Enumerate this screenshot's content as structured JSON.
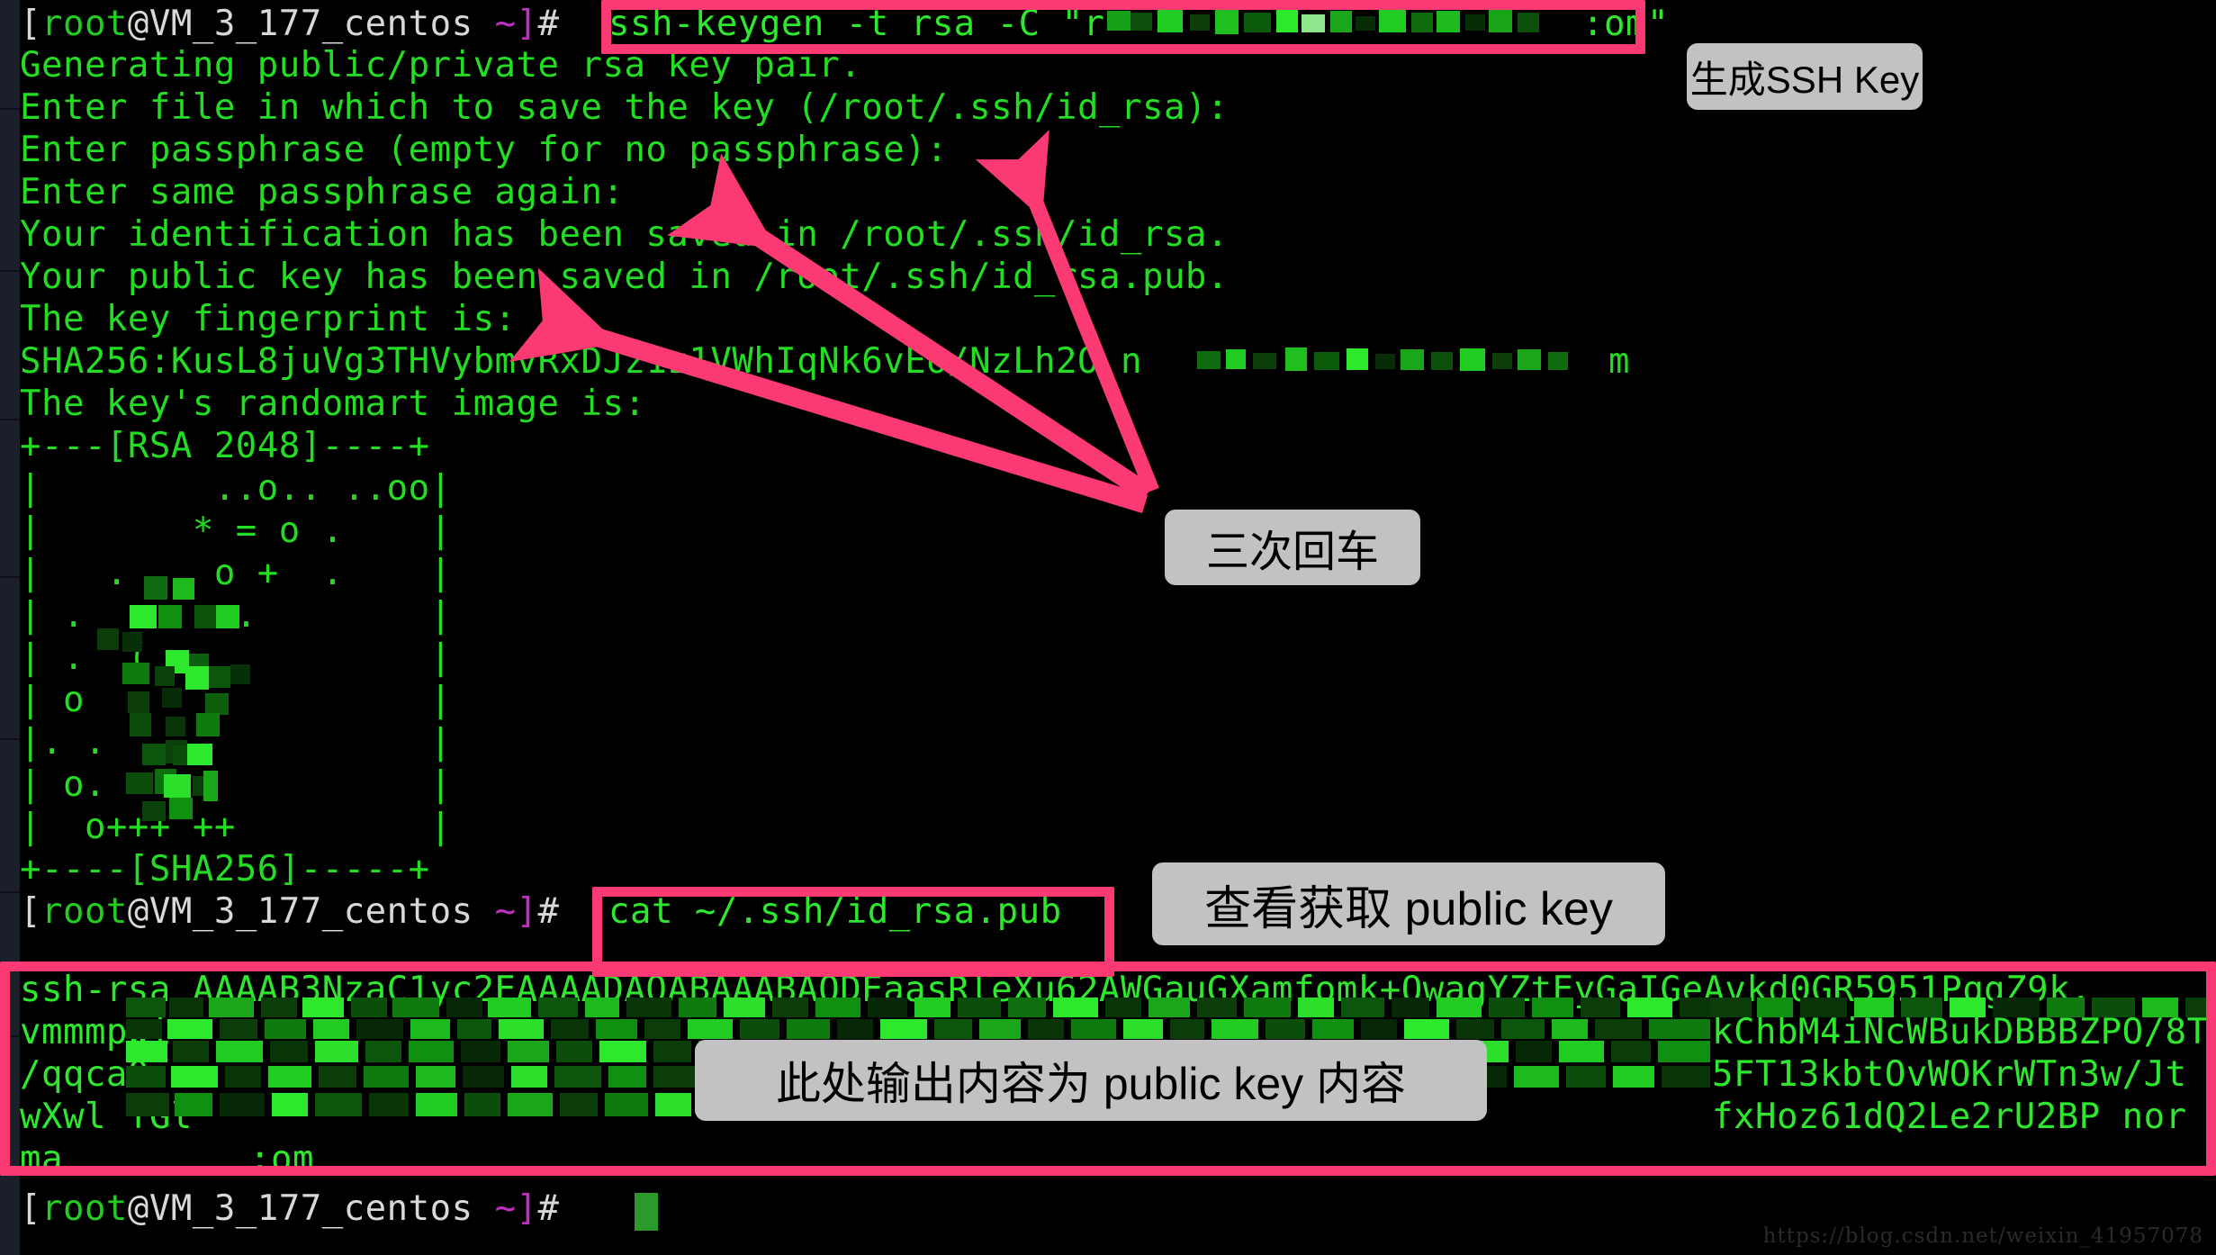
{
  "terminal": {
    "prompt_user": "root",
    "prompt_host": "@VM_3_177_centos",
    "prompt_path": " ~]",
    "prompt_sigil": "#",
    "lines": [
      {
        "id": "l1_cmd",
        "text": "ssh-keygen -t rsa -C \"r"
      },
      {
        "id": "l1_tail",
        "text": ":om\""
      },
      {
        "id": "l2",
        "text": "Generating public/private rsa key pair."
      },
      {
        "id": "l3",
        "text": "Enter file in which to save the key (/root/.ssh/id_rsa):"
      },
      {
        "id": "l4",
        "text": "Enter passphrase (empty for no passphrase):"
      },
      {
        "id": "l5",
        "text": "Enter same passphrase again:"
      },
      {
        "id": "l6",
        "text": "Your identification has been saved in /root/.ssh/id_rsa."
      },
      {
        "id": "l7",
        "text": "Your public key has been saved in /root/.ssh/id_rsa.pub."
      },
      {
        "id": "l8",
        "text": "The key fingerprint is:"
      },
      {
        "id": "l9",
        "text": "SHA256:KusL8juVg3THVybmvRxDJz1z1VWhIqNk6vEo/NzLh2O n"
      },
      {
        "id": "l9_tail",
        "text": "m"
      },
      {
        "id": "l10",
        "text": "The key's randomart image is:"
      },
      {
        "id": "art_top",
        "text": "+---[RSA 2048]----+"
      },
      {
        "id": "art_1",
        "text": "|        ..o.. ..oo|"
      },
      {
        "id": "art_2",
        "text": "|       * = o .    |"
      },
      {
        "id": "art_3",
        "text": "|   .  . o +  .    |"
      },
      {
        "id": "art_4",
        "text": "| .       .        |"
      },
      {
        "id": "art_5",
        "text": "| .  (             |"
      },
      {
        "id": "art_6",
        "text": "| o                |"
      },
      {
        "id": "art_7",
        "text": "|. .               |"
      },
      {
        "id": "art_8",
        "text": "| o.               |"
      },
      {
        "id": "art_9",
        "text": "|  o+++ ++         |"
      },
      {
        "id": "art_bot",
        "text": "+----[SHA256]-----+"
      },
      {
        "id": "cat_cmd",
        "text": "cat ~/.ssh/id_rsa.pub"
      },
      {
        "id": "key_1",
        "text": "ssh-rsa AAAAB3NzaC1yc2EAAAADAQABAAABAQDEaasRleXu62AWGauGXamfomk+OwagYZtEyGaIGeAvkd0GR5951PqgZ9k."
      },
      {
        "id": "key_2a",
        "text": "vmmmpwi"
      },
      {
        "id": "key_2b",
        "text": "kChbM4iNcWBukDBBBZPO/8T"
      },
      {
        "id": "key_3a",
        "text": "/qqca0"
      },
      {
        "id": "key_3b",
        "text": "5FT13kbtOvWOKrWTn3w/Jt"
      },
      {
        "id": "key_4a",
        "text": "wXwl TGl"
      },
      {
        "id": "key_4b",
        "text": "fxHoz61dQ2Le2rU2BP nor"
      },
      {
        "id": "key_5a",
        "text": "ma"
      },
      {
        "id": "key_5b",
        "text": ":om"
      }
    ]
  },
  "annotations": [
    {
      "id": "anno_gen",
      "text": "生成SSH Key"
    },
    {
      "id": "anno_enter",
      "text": "三次回车"
    },
    {
      "id": "anno_cat",
      "text": "查看获取 public key"
    },
    {
      "id": "anno_out",
      "text": "此处输出内容为 public key 内容"
    }
  ],
  "highlight_boxes": [
    {
      "id": "hl_keygen_cmd",
      "label": "ssh-keygen command highlight"
    },
    {
      "id": "hl_cat_cmd",
      "label": "cat command highlight"
    },
    {
      "id": "hl_pubkey",
      "label": "public key output highlight"
    }
  ],
  "colors": {
    "accent_pink": "#fb3a74",
    "terminal_green": "#22dd22",
    "annotation_bg": "#c2c2c2",
    "background": "#000000"
  },
  "watermark": {
    "text": "https://blog.csdn.net/weixin_41957078"
  }
}
